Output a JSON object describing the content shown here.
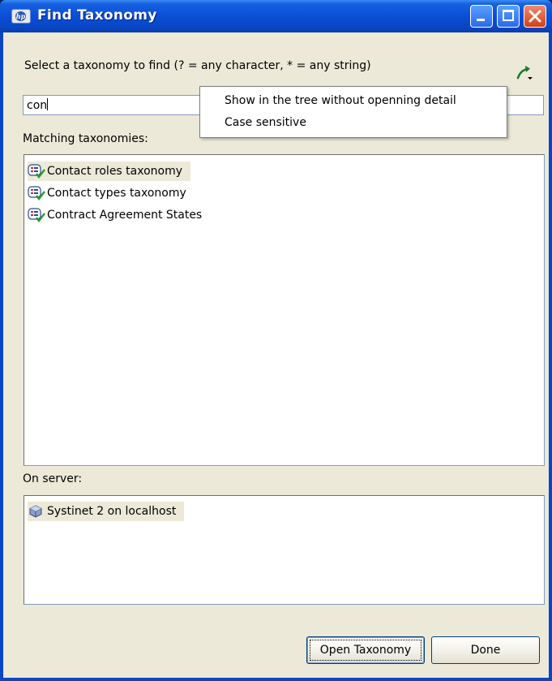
{
  "window": {
    "title": "Find  Taxonomy",
    "controls": [
      "minimize",
      "maximize",
      "close"
    ]
  },
  "prompt": "Select a taxonomy to find (? = any character, * = any string)",
  "search": {
    "value": "con"
  },
  "popup_menu": {
    "items": [
      {
        "label": "Show in the tree without openning detail"
      },
      {
        "label": "Case sensitive"
      }
    ]
  },
  "matching": {
    "label": "Matching taxonomies:",
    "items": [
      {
        "label": "Contact roles taxonomy",
        "icon": "taxonomy-icon",
        "selected": true
      },
      {
        "label": "Contact types taxonomy",
        "icon": "taxonomy-icon",
        "selected": false
      },
      {
        "label": "Contract Agreement States",
        "icon": "taxonomy-icon",
        "selected": false
      }
    ]
  },
  "server": {
    "label": "On server:",
    "items": [
      {
        "label": "Systinet 2 on localhost",
        "icon": "server-icon",
        "selected": true
      }
    ]
  },
  "buttons": {
    "open": "Open Taxonomy",
    "done": "Done"
  },
  "colors": {
    "titlebar": "#0a4fd6",
    "dialog_bg": "#ece9d8",
    "list_border": "#7f9db9"
  }
}
